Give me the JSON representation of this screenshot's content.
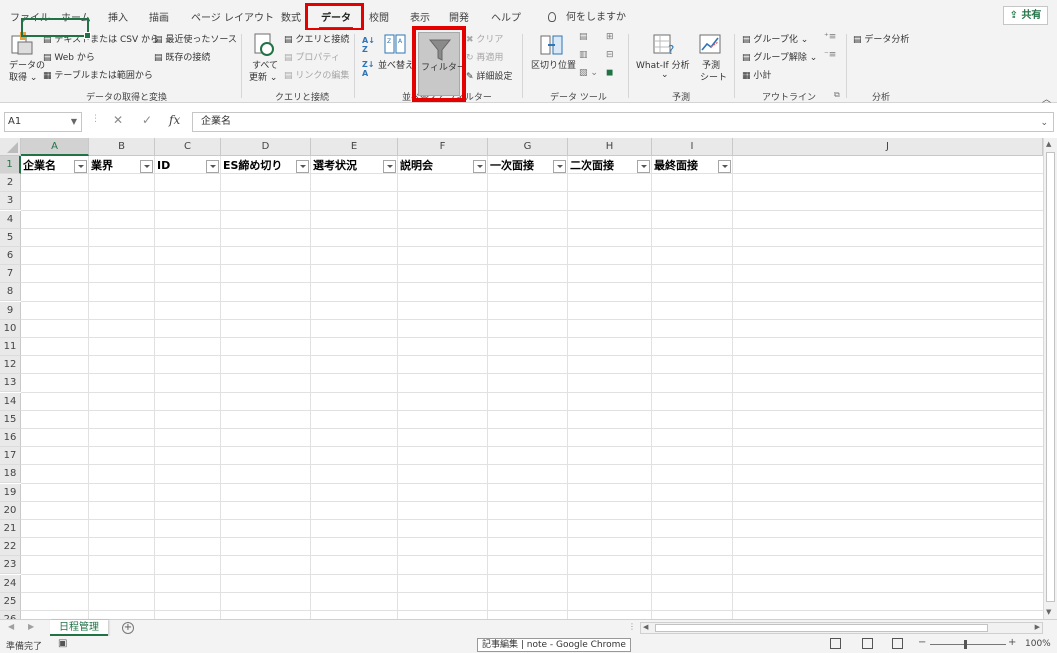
{
  "menu_tabs": [
    "ファイル",
    "ホーム",
    "挿入",
    "描画",
    "ページ レイアウト",
    "数式",
    "データ",
    "校閲",
    "表示",
    "開発",
    "ヘルプ"
  ],
  "active_tab": "データ",
  "tell_me": "何をしますか",
  "share_label": "共有",
  "ribbon": {
    "get_data": {
      "get_data_label_1": "データの",
      "get_data_label_2": "取得 ⌄",
      "from_text_csv": "テキストまたは CSV から",
      "from_web": "Web から",
      "from_table": "テーブルまたは範囲から",
      "recent_sources": "最近使ったソース",
      "existing_connections": "既存の接続",
      "group_label": "データの取得と変換"
    },
    "queries": {
      "refresh_all_1": "すべて",
      "refresh_all_2": "更新 ⌄",
      "queries_connections": "クエリと接続",
      "properties": "プロパティ",
      "edit_links": "リンクの編集",
      "group_label": "クエリと接続"
    },
    "sort_filter": {
      "sort": "並べ替え",
      "filter": "フィルター",
      "clear": "クリア",
      "reapply": "再適用",
      "advanced": "詳細設定",
      "group_label": "並べ替えとフィルター"
    },
    "data_tools": {
      "text_to_columns": "区切り位置",
      "group_label": "データ ツール"
    },
    "forecast": {
      "what_if": "What-If 分析",
      "what_if_dd": "⌄",
      "forecast_sheet_1": "予測",
      "forecast_sheet_2": "シート",
      "group_label": "予測"
    },
    "outline": {
      "group": "グループ化",
      "ungroup": "グループ解除",
      "subtotal": "小計",
      "group_label": "アウトライン"
    },
    "analysis": {
      "data_analysis": "データ分析",
      "group_label": "分析"
    }
  },
  "formula_bar": {
    "name_box": "A1",
    "cancel": "✕",
    "enter": "✓",
    "fx": "fx",
    "content": "企業名"
  },
  "columns": [
    "A",
    "B",
    "C",
    "D",
    "E",
    "F",
    "G",
    "H",
    "I",
    "J"
  ],
  "rows": [
    "1",
    "2",
    "3",
    "4",
    "5",
    "6",
    "7",
    "8",
    "9",
    "10",
    "11",
    "12",
    "13",
    "14",
    "15",
    "16",
    "17",
    "18",
    "19",
    "20",
    "21",
    "22",
    "23",
    "24",
    "25",
    "26"
  ],
  "header_cells": [
    "企業名",
    "業界",
    "ID",
    "ES締め切り",
    "選考状況",
    "説明会",
    "一次面接",
    "二次面接",
    "最終面接"
  ],
  "sheet_tab": "日程管理",
  "status": {
    "ready": "準備完了",
    "taskbar_tooltip": "記事編集 | note - Google Chrome",
    "zoom": "100%",
    "zoom_minus": "−",
    "zoom_plus": "+"
  },
  "colors": {
    "excel_green": "#217346",
    "highlight_red": "#e50000",
    "ribbon_bg": "#f3f3f3"
  }
}
